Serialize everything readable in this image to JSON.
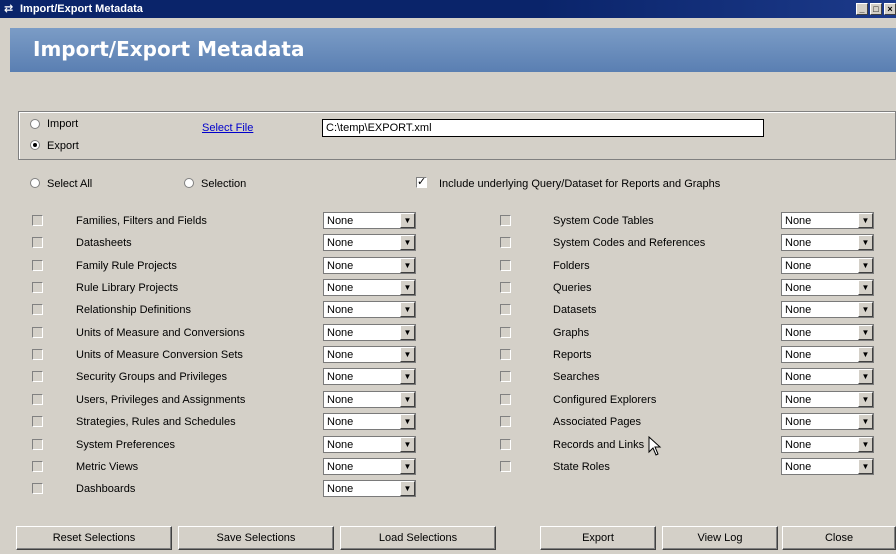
{
  "window": {
    "title": "Import/Export Metadata",
    "icon": "import-export-icon"
  },
  "header": {
    "title": "Import/Export Metadata"
  },
  "mode": {
    "import_label": "Import",
    "export_label": "Export",
    "selected": "Export",
    "select_file_label": "Select File",
    "file_path": "C:\\temp\\EXPORT.xml"
  },
  "selection": {
    "select_all_label": "Select All",
    "selection_label": "Selection",
    "include_label": "Include underlying Query/Dataset for Reports and Graphs",
    "include_checked": true
  },
  "left_items": [
    {
      "label": "Families, Filters and Fields",
      "value": "None"
    },
    {
      "label": "Datasheets",
      "value": "None"
    },
    {
      "label": "Family Rule Projects",
      "value": "None"
    },
    {
      "label": "Rule Library Projects",
      "value": "None"
    },
    {
      "label": "Relationship Definitions",
      "value": "None"
    },
    {
      "label": "Units of Measure and Conversions",
      "value": "None"
    },
    {
      "label": "Units of Measure Conversion Sets",
      "value": "None"
    },
    {
      "label": "Security Groups and Privileges",
      "value": "None"
    },
    {
      "label": "Users, Privileges and Assignments",
      "value": "None"
    },
    {
      "label": "Strategies, Rules and Schedules",
      "value": "None"
    },
    {
      "label": "System Preferences",
      "value": "None"
    },
    {
      "label": "Metric Views",
      "value": "None"
    },
    {
      "label": "Dashboards",
      "value": "None"
    }
  ],
  "right_items": [
    {
      "label": "System Code Tables",
      "value": "None"
    },
    {
      "label": "System Codes and References",
      "value": "None"
    },
    {
      "label": "Folders",
      "value": "None"
    },
    {
      "label": "Queries",
      "value": "None"
    },
    {
      "label": "Datasets",
      "value": "None"
    },
    {
      "label": "Graphs",
      "value": "None"
    },
    {
      "label": "Reports",
      "value": "None"
    },
    {
      "label": "Searches",
      "value": "None"
    },
    {
      "label": "Configured Explorers",
      "value": "None"
    },
    {
      "label": "Associated Pages",
      "value": "None"
    },
    {
      "label": "Records and Links",
      "value": "None"
    },
    {
      "label": "State Roles",
      "value": "None"
    }
  ],
  "buttons": {
    "reset": "Reset Selections",
    "save": "Save Selections",
    "load": "Load Selections",
    "export": "Export",
    "view_log": "View Log",
    "close": "Close"
  }
}
